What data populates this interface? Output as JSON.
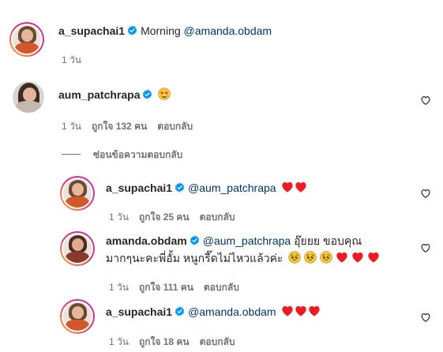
{
  "comments": [
    {
      "username": "a_supachai1",
      "text": "Morning",
      "mention": "@amanda.obdam",
      "time": "1 วัน"
    },
    {
      "username": "aum_patchrapa",
      "emoji": "star-struck",
      "time": "1 วัน",
      "likes": "ถูกใจ 132 คน",
      "reply": "ตอบกลับ"
    }
  ],
  "hide_replies_label": "ซ่อนข้อความตอบกลับ",
  "replies": [
    {
      "username": "a_supachai1",
      "mention": "@aum_patchrapa",
      "emojis": [
        "red-heart",
        "red-heart"
      ],
      "time": "1 วัน",
      "likes": "ถูกใจ 25 คน",
      "reply": "ตอบกลับ"
    },
    {
      "username": "amanda.obdam",
      "mention": "@aum_patchrapa",
      "text_line1": "อุ๊ยยย ขอบคุณ",
      "text_line2": "มากๆนะคะพี่อั้ม หนูกรี๊ดไม่ไหวแล้วค่ะ",
      "emojis": [
        "pleading-face",
        "pleading-face",
        "pleading-face",
        "red-heart",
        "red-heart",
        "red-heart"
      ],
      "time": "1 วัน",
      "likes": "ถูกใจ 111 คน",
      "reply": "ตอบกลับ"
    },
    {
      "username": "a_supachai1",
      "mention": "@amanda.obdam",
      "emojis": [
        "red-heart",
        "red-heart",
        "red-heart"
      ],
      "time": "1 วัน",
      "likes": "ถูกใจ 18 คน",
      "reply": "ตอบกลับ"
    }
  ],
  "colors": {
    "text": "#262626",
    "meta": "#737373",
    "mention": "#00376b",
    "verified": "#0095f6",
    "heart": "#ed1c24"
  }
}
